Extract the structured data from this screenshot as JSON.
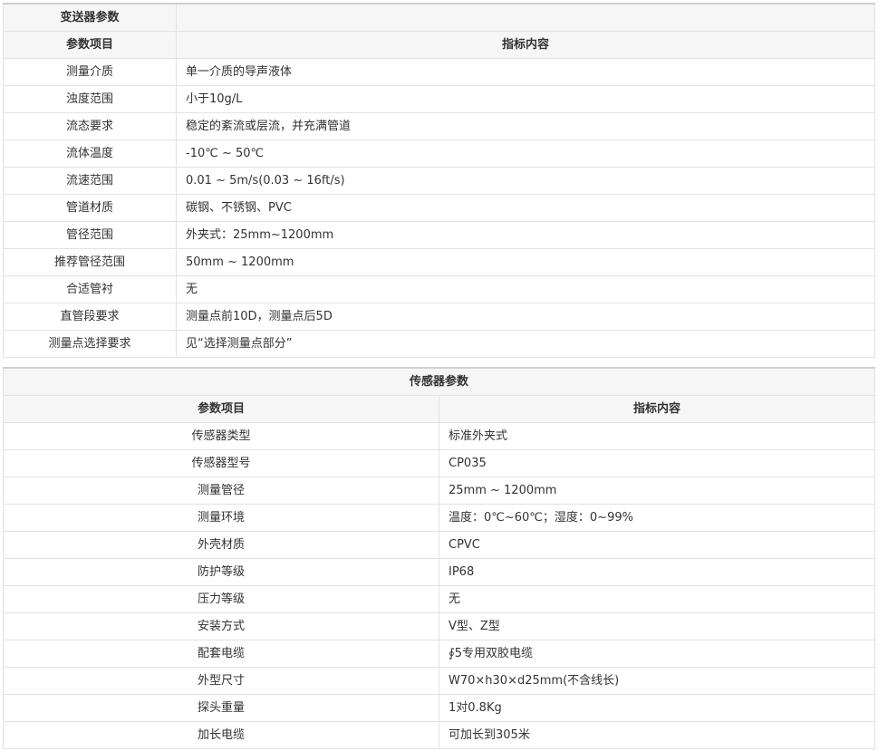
{
  "transmitter": {
    "title": "变送器参数",
    "col_item": "参数项目",
    "col_value": "指标内容",
    "rows": [
      {
        "k": "测量介质",
        "v": "单一介质的导声液体"
      },
      {
        "k": "浊度范围",
        "v": "小于10g/L"
      },
      {
        "k": "流态要求",
        "v": "稳定的紊流或层流，并充满管道"
      },
      {
        "k": "流体温度",
        "v": "-10℃ ~ 50℃"
      },
      {
        "k": "流速范围",
        "v": "0.01 ~ 5m/s(0.03 ~ 16ft/s)"
      },
      {
        "k": "管道材质",
        "v": "碳钢、不锈钢、PVC"
      },
      {
        "k": "管径范围",
        "v": "外夹式：25mm~1200mm"
      },
      {
        "k": "推荐管径范围",
        "v": "50mm ~ 1200mm"
      },
      {
        "k": "合适管衬",
        "v": "无"
      },
      {
        "k": "直管段要求",
        "v": "测量点前10D，测量点后5D"
      },
      {
        "k": "测量点选择要求",
        "v": "见“选择测量点部分”"
      }
    ]
  },
  "sensor": {
    "title": "传感器参数",
    "col_item": "参数项目",
    "col_value": "指标内容",
    "rows": [
      {
        "k": "传感器类型",
        "v": "标准外夹式"
      },
      {
        "k": "传感器型号",
        "v": "CP035"
      },
      {
        "k": "测量管径",
        "v": "25mm ~ 1200mm"
      },
      {
        "k": "测量环境",
        "v": "温度：0℃~60℃；湿度：0~99%"
      },
      {
        "k": "外壳材质",
        "v": "CPVC"
      },
      {
        "k": "防护等级",
        "v": "IP68"
      },
      {
        "k": "压力等级",
        "v": "无"
      },
      {
        "k": "安装方式",
        "v": "V型、Z型"
      },
      {
        "k": "配套电缆",
        "v": "∮5专用双胶电缆"
      },
      {
        "k": "外型尺寸",
        "v": "W70×h30×d25mm(不含线长)"
      },
      {
        "k": "探头重量",
        "v": "1对0.8Kg"
      },
      {
        "k": "加长电缆",
        "v": "可加长到305米"
      }
    ]
  }
}
